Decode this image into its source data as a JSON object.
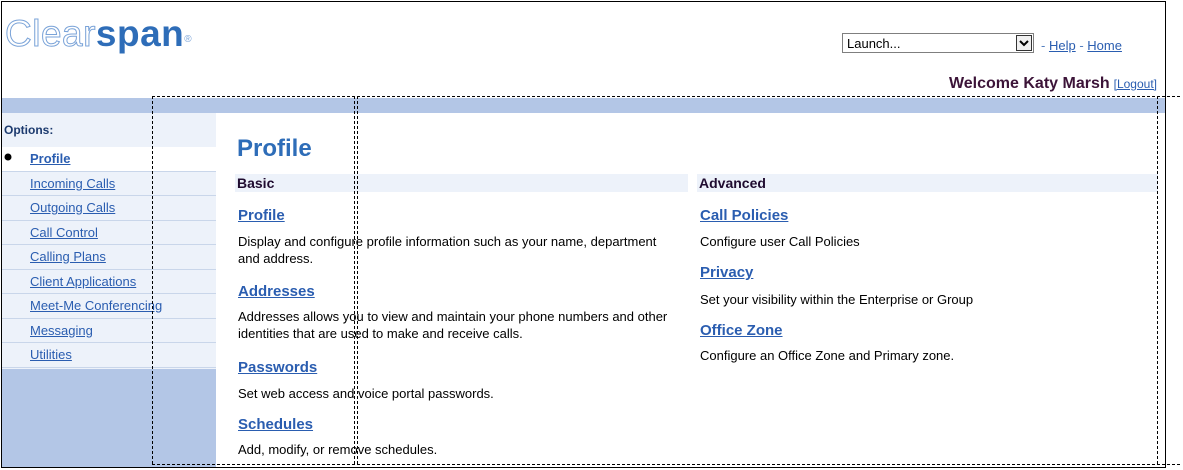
{
  "header": {
    "logo_part1": "Clear",
    "logo_part2": "span",
    "logo_mark": "®",
    "launch_value": "Launch...",
    "sep1": "- ",
    "help_link": "Help",
    "sep2": " - ",
    "home_link": "Home",
    "welcome": "Welcome Katy Marsh",
    "logout": "[Logout]"
  },
  "sidebar": {
    "title": "Options:",
    "items": [
      {
        "label": "Profile",
        "active": true
      },
      {
        "label": "Incoming Calls"
      },
      {
        "label": "Outgoing Calls"
      },
      {
        "label": "Call Control"
      },
      {
        "label": "Calling Plans"
      },
      {
        "label": "Client Applications"
      },
      {
        "label": "Meet-Me Conferencing"
      },
      {
        "label": "Messaging"
      },
      {
        "label": "Utilities"
      }
    ]
  },
  "main": {
    "title": "Profile",
    "basic": {
      "heading": "Basic",
      "items": [
        {
          "title": "Profile",
          "desc": "Display and configure profile information such as your name, department and address."
        },
        {
          "title": "Addresses",
          "desc": "Addresses allows you to view and maintain your phone numbers and other identities that are used to make and receive calls."
        },
        {
          "title": "Passwords",
          "desc": "Set web access and voice portal passwords."
        },
        {
          "title": "Schedules",
          "desc": "Add, modify, or remove schedules."
        }
      ]
    },
    "advanced": {
      "heading": "Advanced",
      "items": [
        {
          "title": "Call Policies",
          "desc": "Configure user Call Policies"
        },
        {
          "title": "Privacy",
          "desc": "Set your visibility within the Enterprise or Group"
        },
        {
          "title": "Office Zone",
          "desc": "Configure an Office Zone and Primary zone."
        }
      ]
    }
  },
  "colors": {
    "brand_blue": "#2e6db8",
    "link_blue": "#2a5db0",
    "band_blue": "#b3c6e6",
    "welcome_purple": "#3c1438"
  },
  "icons": {
    "launch_dropdown": "chevron-down-icon",
    "active_marker": "bullet-icon"
  }
}
